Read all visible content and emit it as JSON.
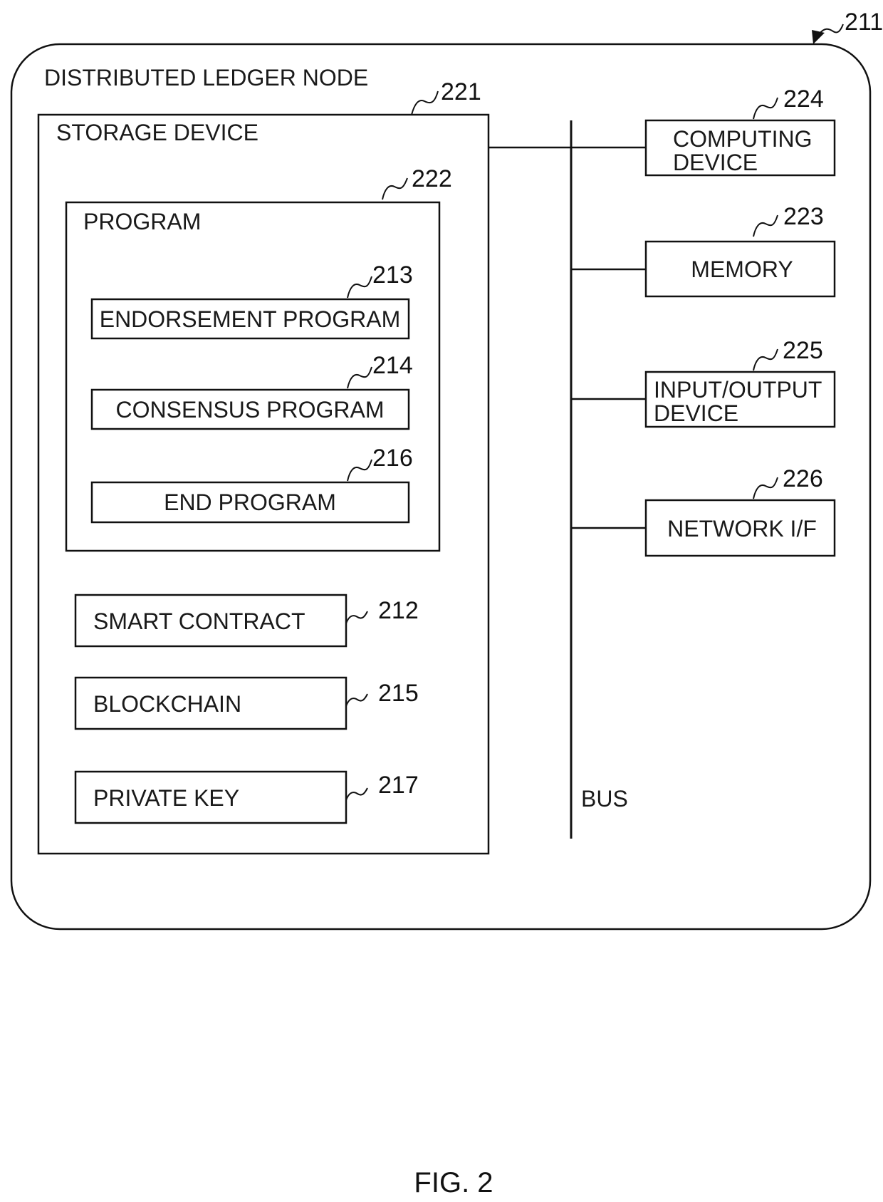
{
  "figure": {
    "caption": "FIG. 2",
    "node": {
      "label": "DISTRIBUTED LEDGER NODE",
      "ref": "211"
    },
    "storage_device": {
      "label": "STORAGE DEVICE",
      "ref": "221"
    },
    "program": {
      "label": "PROGRAM",
      "ref": "222"
    },
    "program_items": [
      {
        "label": "ENDORSEMENT PROGRAM",
        "ref": "213"
      },
      {
        "label": "CONSENSUS PROGRAM",
        "ref": "214"
      },
      {
        "label": "END PROGRAM",
        "ref": "216"
      }
    ],
    "storage_items": [
      {
        "label": "SMART CONTRACT",
        "ref": "212"
      },
      {
        "label": "BLOCKCHAIN",
        "ref": "215"
      },
      {
        "label": "PRIVATE KEY",
        "ref": "217"
      }
    ],
    "bus": {
      "label": "BUS"
    },
    "bus_devices": [
      {
        "line1": "COMPUTING",
        "line2": "DEVICE",
        "ref": "224"
      },
      {
        "line1": "MEMORY",
        "line2": "",
        "ref": "223"
      },
      {
        "line1": "INPUT/OUTPUT",
        "line2": "DEVICE",
        "ref": "225"
      },
      {
        "line1": "NETWORK I/F",
        "line2": "",
        "ref": "226"
      }
    ]
  }
}
